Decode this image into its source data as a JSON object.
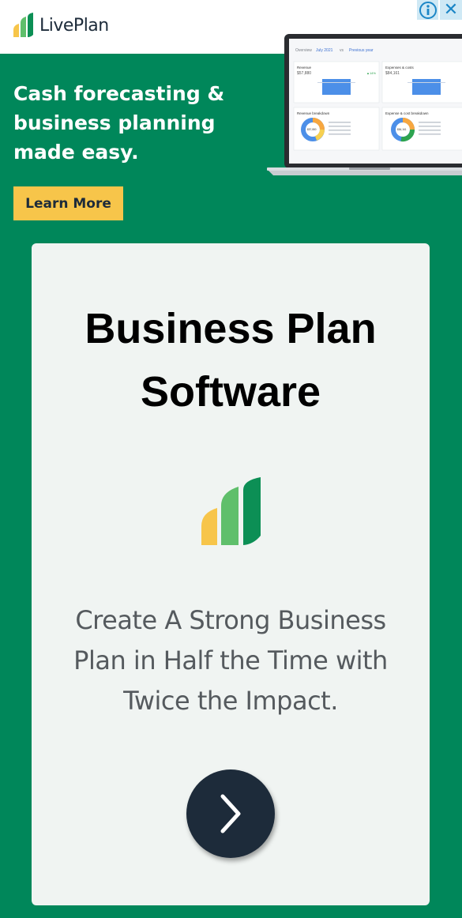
{
  "brand": {
    "name": "LivePlan"
  },
  "ad_controls": {
    "info_icon": "info-icon",
    "close_icon": "close-icon",
    "close_glyph": "✕"
  },
  "hero": {
    "headline": "Cash forecasting & business planning made easy.",
    "cta_label": "Learn More"
  },
  "dashboard": {
    "nav_overview": "Overview",
    "nav_period": "July 2021",
    "nav_vs": "vs",
    "nav_compare": "Previous year",
    "revenue_label": "Revenue",
    "revenue_value": "$57,880",
    "revenue_delta": "▲14%",
    "expenses_label": "Expenses & costs",
    "expenses_value": "$84,161",
    "rev_breakdown_label": "Revenue breakdown",
    "rev_donut_value": "$57,880",
    "exp_breakdown_label": "Expense & cost breakdown",
    "exp_donut_value": "$84,161"
  },
  "card": {
    "title": "Business Plan Software",
    "subtitle": "Create A Strong Business Plan in Half the Time with Twice the Impact.",
    "next_icon": "chevron-right-icon"
  },
  "colors": {
    "background": "#00875a",
    "cta": "#f7c54a",
    "dark": "#1d2b3a",
    "logo_yellow": "#f7c54a",
    "logo_light_green": "#5fbf6b",
    "logo_green": "#0c8f55"
  }
}
